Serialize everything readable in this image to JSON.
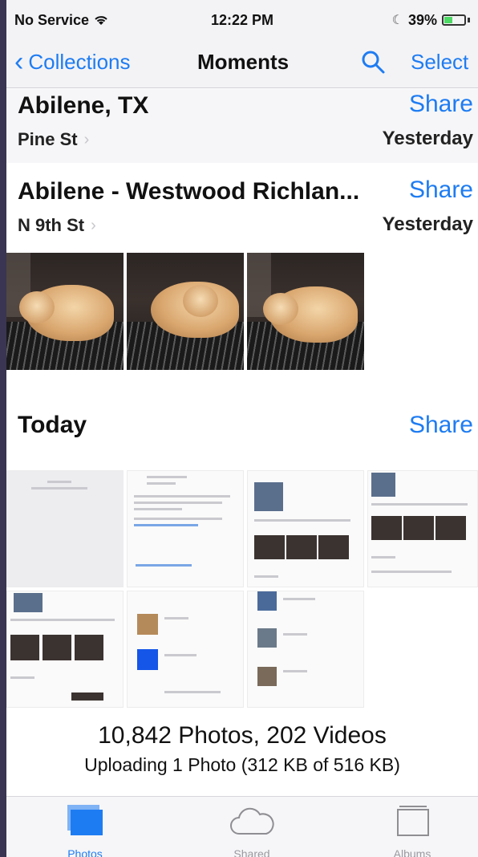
{
  "status": {
    "carrier": "No Service",
    "time": "12:22 PM",
    "battery": "39%"
  },
  "nav": {
    "back": "Collections",
    "title": "Moments",
    "select": "Select"
  },
  "moments": [
    {
      "title": "Abilene, TX",
      "share": "Share",
      "location": "Pine St",
      "date": "Yesterday"
    },
    {
      "title": "Abilene - Westwood Richlan...",
      "share": "Share",
      "location": "N 9th St",
      "date": "Yesterday"
    },
    {
      "title": "Today",
      "share": "Share"
    }
  ],
  "summary": {
    "counts": "10,842 Photos, 202 Videos",
    "upload": "Uploading 1 Photo (312 KB of 516 KB)"
  },
  "tabs": [
    {
      "label": "Photos",
      "icon": "photos-icon",
      "active": true
    },
    {
      "label": "Shared",
      "icon": "cloud-icon",
      "active": false
    },
    {
      "label": "Albums",
      "icon": "albums-icon",
      "active": false
    }
  ],
  "colors": {
    "accent": "#1e7cf2",
    "pink_mark": "#e23bd6"
  }
}
